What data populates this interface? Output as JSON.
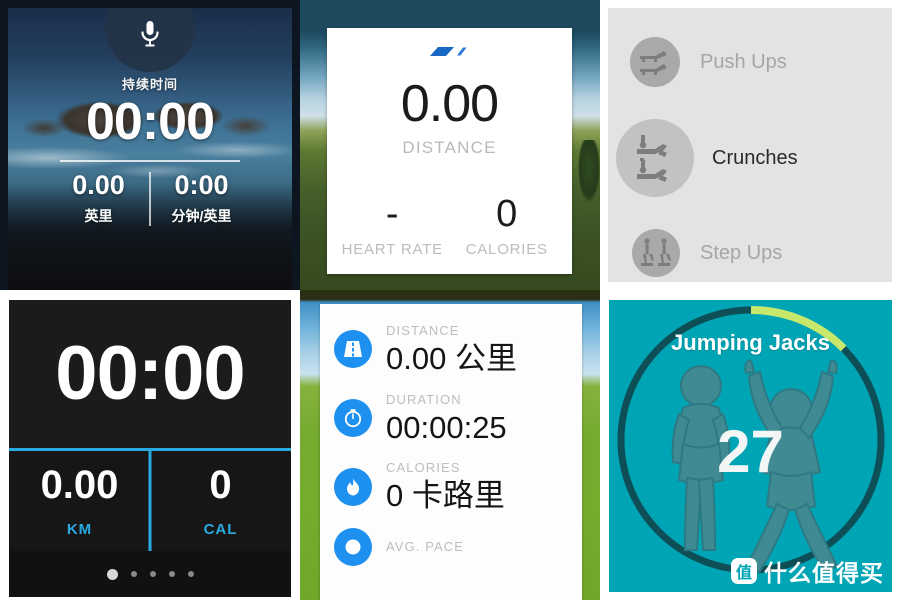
{
  "panels": {
    "run_tracker_beach": {
      "mic_icon": "microphone-icon",
      "duration_label": "持续时间",
      "duration_value": "00:00",
      "distance_value": "0.00",
      "distance_unit": "英里",
      "pace_value": "0:00",
      "pace_unit": "分钟/英里"
    },
    "runtastic_card": {
      "logo": "runtastic-logo",
      "distance_value": "0.00",
      "distance_label": "DISTANCE",
      "heart_rate_value": "-",
      "heart_rate_label": "HEART RATE",
      "calories_value": "0",
      "calories_label": "CALORIES"
    },
    "exercise_list": {
      "items": [
        {
          "label": "Push Ups",
          "icon": "push-ups-icon",
          "state": "inactive"
        },
        {
          "label": "Crunches",
          "icon": "crunches-icon",
          "state": "active"
        },
        {
          "label": "Step Ups",
          "icon": "step-ups-icon",
          "state": "inactive"
        }
      ]
    },
    "dark_stopwatch": {
      "time_value": "00:00",
      "distance_value": "0.00",
      "distance_unit": "KM",
      "calories_value": "0",
      "calories_unit": "CAL",
      "page_dots_total": 5,
      "page_dots_active_index": 0
    },
    "metrics_card": {
      "rows": [
        {
          "label": "DISTANCE",
          "value": "0.00 公里",
          "icon": "road-icon"
        },
        {
          "label": "DURATION",
          "value": "00:00:25",
          "icon": "stopwatch-icon"
        },
        {
          "label": "CALORIES",
          "value": "0 卡路里",
          "icon": "flame-icon"
        },
        {
          "label": "AVG. PACE",
          "value": "",
          "icon": "pace-icon"
        }
      ]
    },
    "jumping_jacks": {
      "title": "Jumping Jacks",
      "count": "27",
      "progress_percent": 18,
      "ring_color": "#0E4F57",
      "progress_color": "#C8E86B",
      "background_color": "#00A5B5"
    }
  },
  "watermark": {
    "logo_char": "值",
    "text": "什么值得买"
  },
  "colors": {
    "accent_blue": "#29ABE2",
    "metric_blue": "#1E90F0",
    "teal": "#00A5B5",
    "lime": "#C8E86B"
  }
}
